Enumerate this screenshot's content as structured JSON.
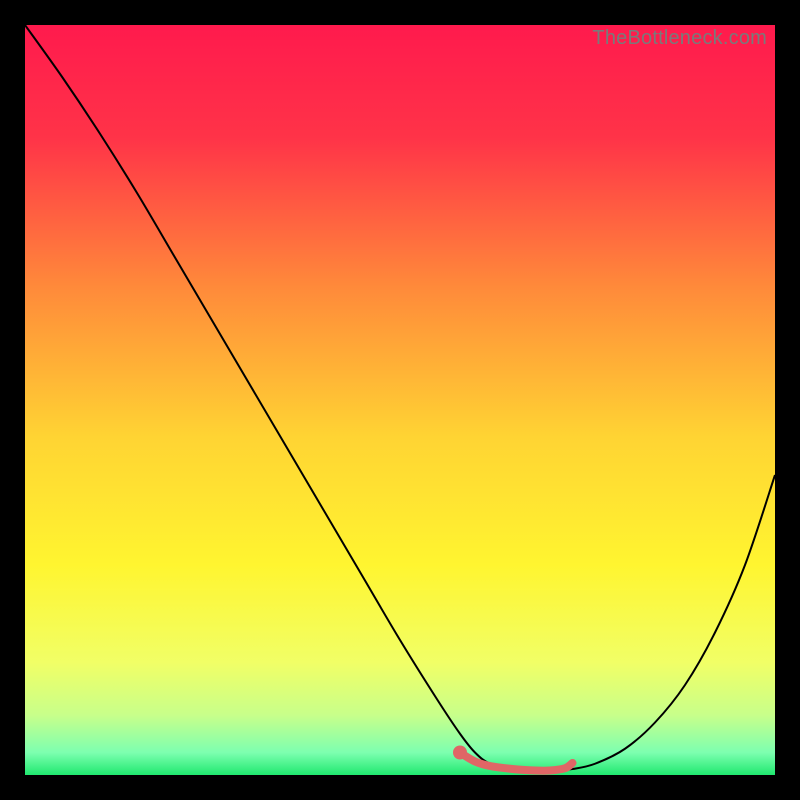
{
  "watermark": "TheBottleneck.com",
  "chart_data": {
    "type": "line",
    "title": "",
    "xlabel": "",
    "ylabel": "",
    "xlim": [
      0,
      100
    ],
    "ylim": [
      0,
      100
    ],
    "background_gradient": {
      "stops": [
        {
          "offset": 0.0,
          "color": "#ff1a4d"
        },
        {
          "offset": 0.15,
          "color": "#ff3348"
        },
        {
          "offset": 0.35,
          "color": "#ff8a3a"
        },
        {
          "offset": 0.55,
          "color": "#ffd433"
        },
        {
          "offset": 0.72,
          "color": "#fff530"
        },
        {
          "offset": 0.85,
          "color": "#f1ff66"
        },
        {
          "offset": 0.92,
          "color": "#c8ff8a"
        },
        {
          "offset": 0.97,
          "color": "#7dffb0"
        },
        {
          "offset": 1.0,
          "color": "#20e86f"
        }
      ]
    },
    "series": [
      {
        "name": "bottleneck-curve",
        "color": "#000000",
        "width": 2,
        "x": [
          0,
          5,
          10,
          15,
          20,
          25,
          30,
          35,
          40,
          45,
          50,
          55,
          58,
          60,
          62,
          65,
          68,
          70,
          73,
          76,
          80,
          84,
          88,
          92,
          96,
          100
        ],
        "y": [
          100,
          93,
          85.5,
          77.5,
          69,
          60.5,
          52,
          43.5,
          35,
          26.5,
          18,
          10,
          5.5,
          3,
          1.5,
          0.7,
          0.5,
          0.5,
          0.8,
          1.5,
          3.5,
          7,
          12,
          19,
          28,
          40
        ]
      }
    ],
    "highlight_band": {
      "name": "optimal-range",
      "color": "#e06666",
      "x_start": 58,
      "x_end": 73,
      "y_start": 0.5,
      "y_end": 3.0,
      "thickness": 8,
      "x": [
        58,
        60,
        62,
        65,
        68,
        70,
        72,
        73
      ],
      "y": [
        3.0,
        1.8,
        1.2,
        0.8,
        0.6,
        0.6,
        0.9,
        1.6
      ]
    }
  }
}
